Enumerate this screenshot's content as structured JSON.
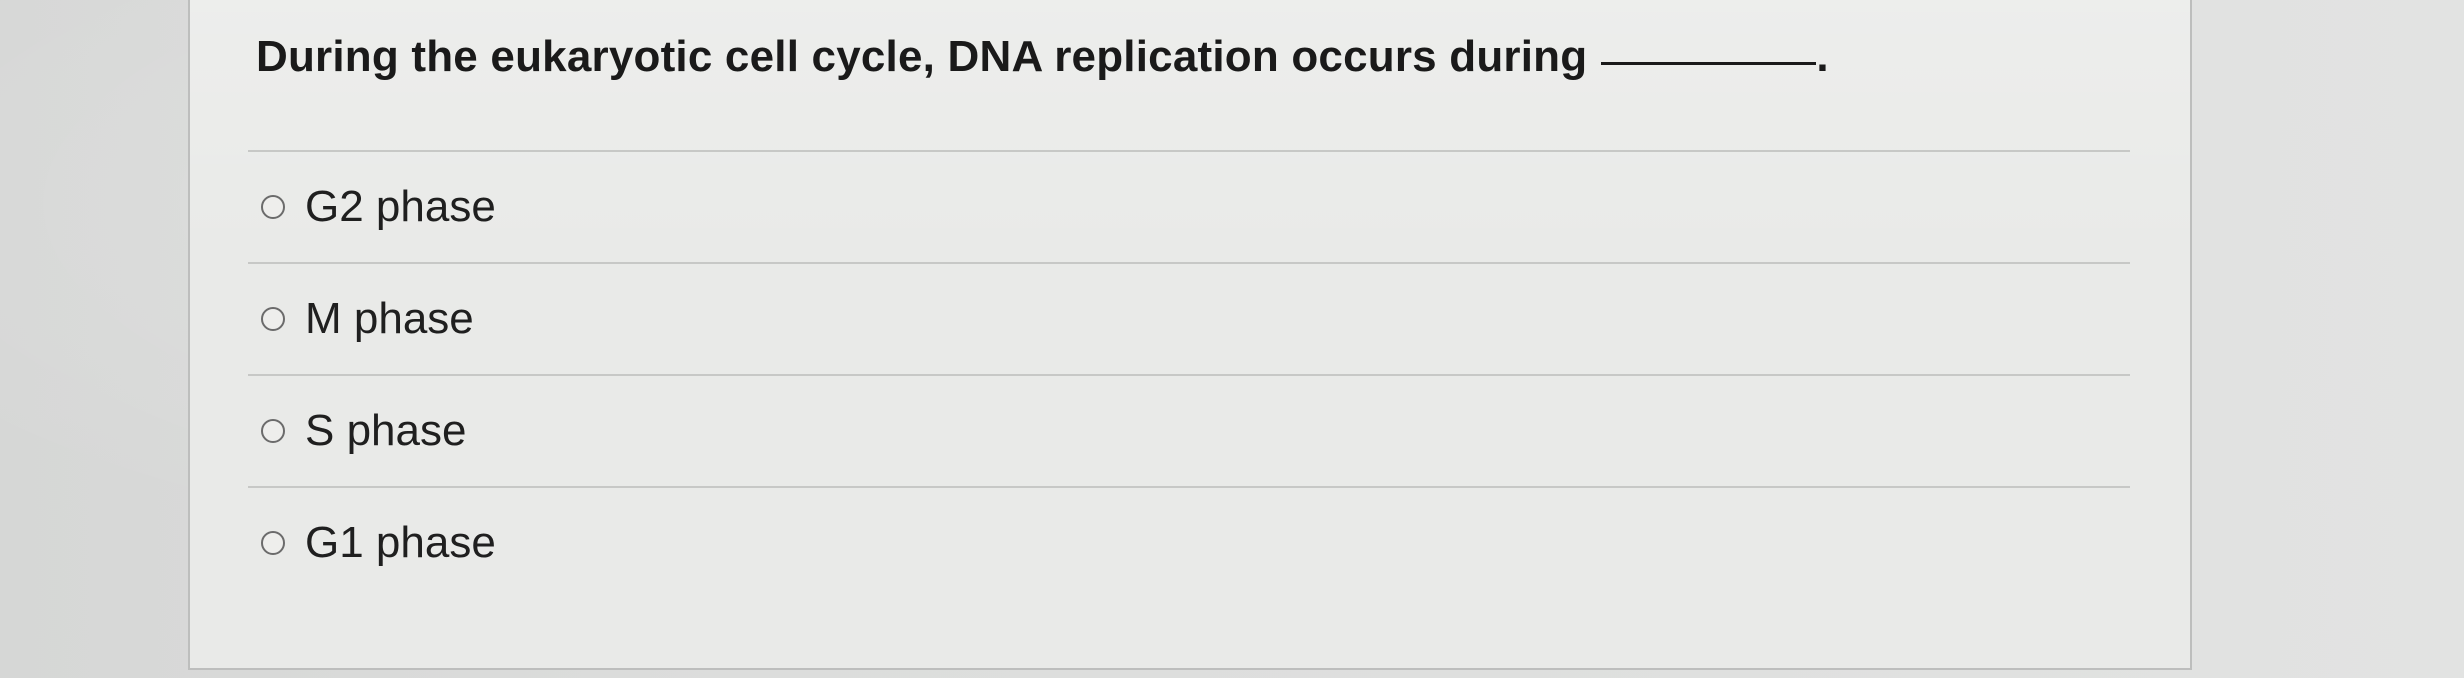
{
  "question": {
    "text": "During the eukaryotic cell cycle, DNA replication occurs during",
    "trailing": "."
  },
  "options": [
    {
      "label": "G2 phase",
      "selected": false
    },
    {
      "label": "M phase",
      "selected": false
    },
    {
      "label": "S phase",
      "selected": false
    },
    {
      "label": "G1 phase",
      "selected": false
    }
  ]
}
